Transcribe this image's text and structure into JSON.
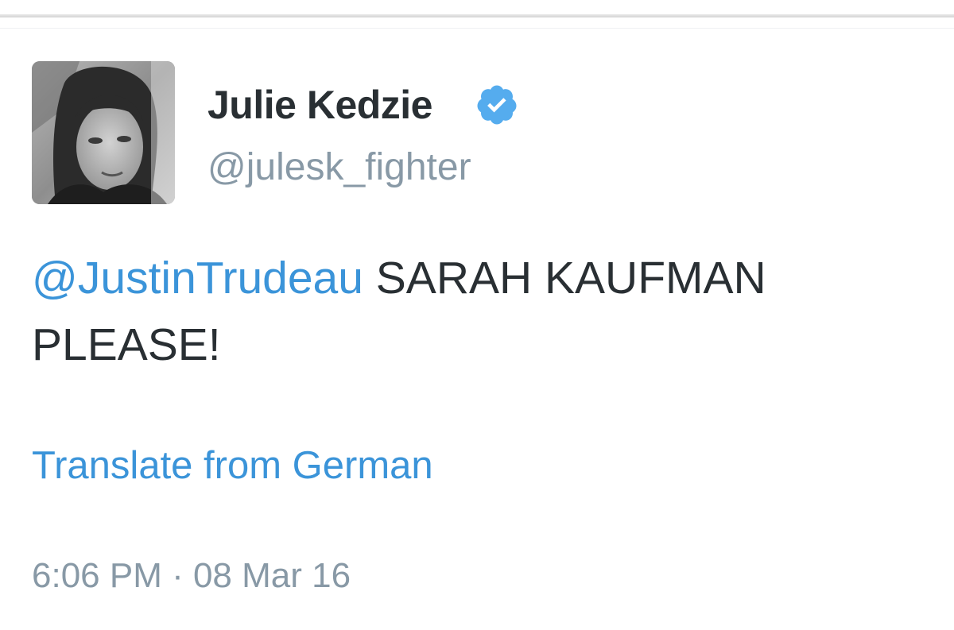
{
  "tweet": {
    "author": {
      "display_name": "Julie Kedzie",
      "handle": "@julesk_fighter",
      "verified": true
    },
    "mention": "@JustinTrudeau",
    "text": " SARAH KAUFMAN PLEASE!",
    "translate_label": "Translate from German",
    "timestamp": "6:06 PM · 08 Mar 16"
  },
  "colors": {
    "link_blue": "#3b94d9",
    "verified_blue": "#55acee",
    "text_dark": "#292f33",
    "text_gray": "#8899a6"
  },
  "icons": {
    "verified": "verified-badge-icon",
    "avatar": "profile-photo"
  }
}
